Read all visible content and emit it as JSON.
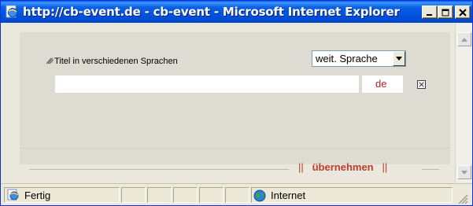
{
  "window": {
    "title": "http://cb-event.de - cb-event - Microsoft Internet Explorer",
    "title_icon": "ie-page-icon",
    "controls": {
      "minimize": "minimize-icon",
      "maximize": "maximize-icon",
      "close": "close-icon"
    }
  },
  "form": {
    "field_label": "Titel in verschiedenen Sprachen",
    "title_input_value": "",
    "language_select": {
      "selected": "weit. Sprache"
    },
    "language_code": "de",
    "remove_icon": "checkbox-x-icon"
  },
  "footer": {
    "sep_left": "||",
    "action_label": "übernehmen",
    "sep_right": "||"
  },
  "statusbar": {
    "status_text": "Fertig",
    "zone_text": "Internet"
  },
  "colors": {
    "title_bar": "#0054e3",
    "accent_red": "#c0392b",
    "panel": "#dedbd3"
  }
}
